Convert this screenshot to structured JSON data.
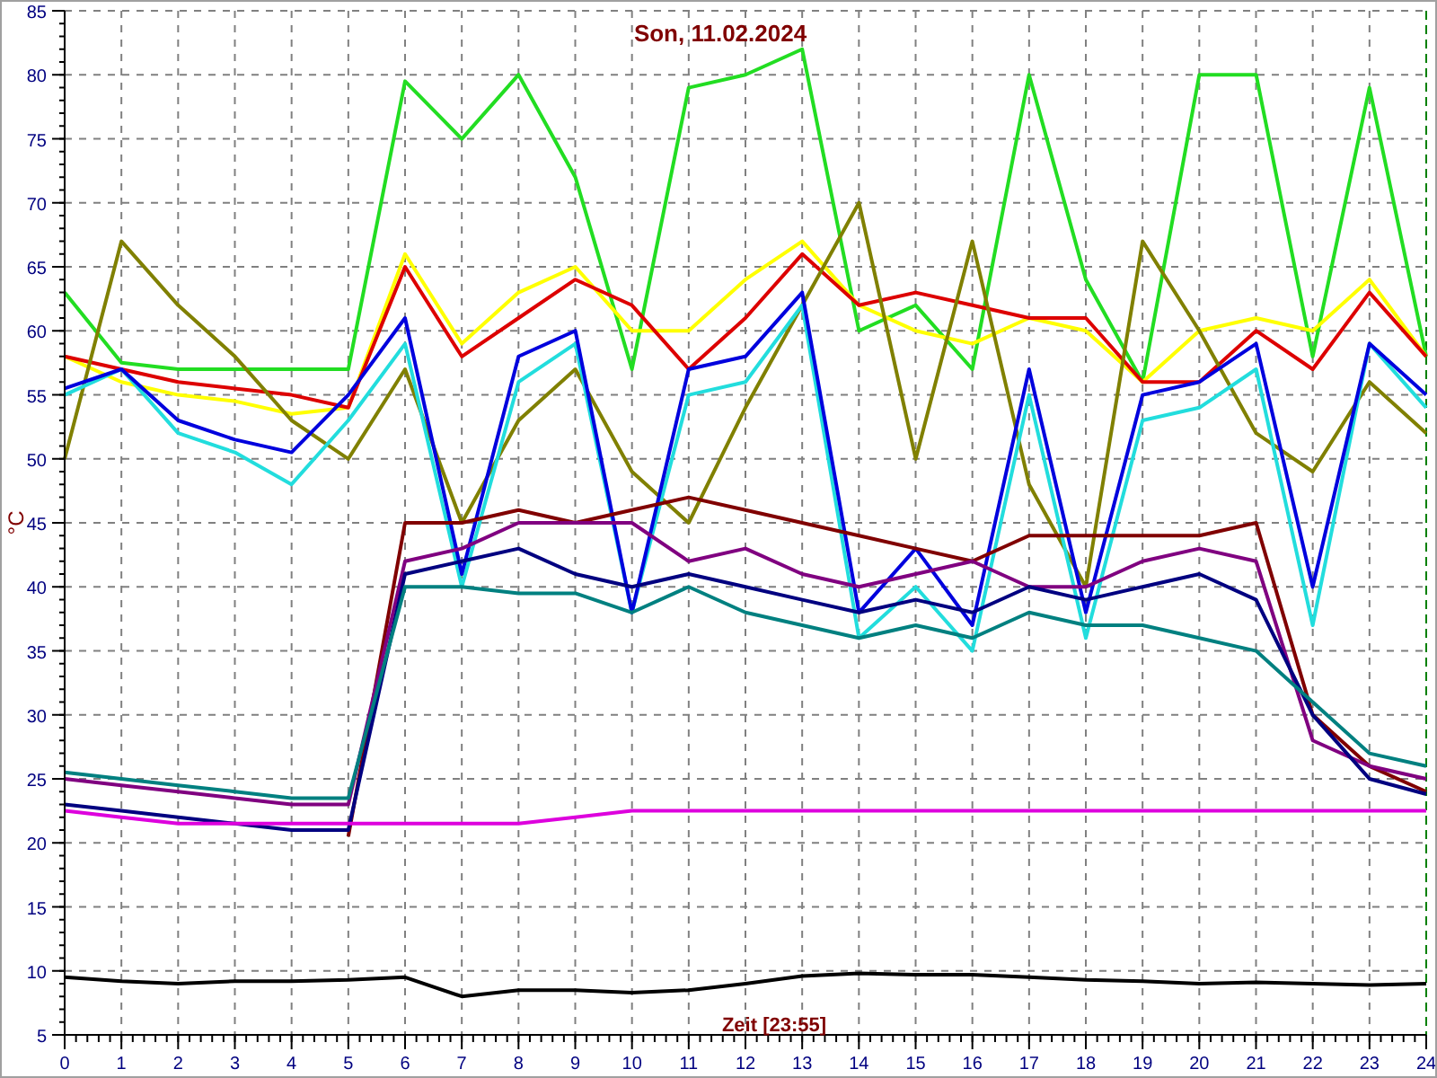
{
  "chart": {
    "chart_data": {
      "type": "line",
      "title": "Son, 11.02.2024",
      "xlabel": "Zeit [23:55]",
      "ylabel": "°C",
      "x": [
        0,
        1,
        2,
        3,
        4,
        5,
        6,
        7,
        8,
        9,
        10,
        11,
        12,
        13,
        14,
        15,
        16,
        17,
        18,
        19,
        20,
        21,
        22,
        23,
        24
      ],
      "grid": true,
      "xlim": [
        0,
        24
      ],
      "ylim": [
        5,
        85
      ],
      "xticks": [
        0,
        1,
        2,
        3,
        4,
        5,
        6,
        7,
        8,
        9,
        10,
        11,
        12,
        13,
        14,
        15,
        16,
        17,
        18,
        19,
        20,
        21,
        22,
        23,
        24
      ],
      "yticks": [
        5,
        10,
        15,
        20,
        25,
        30,
        35,
        40,
        45,
        50,
        55,
        60,
        65,
        70,
        75,
        80,
        85
      ],
      "series": [
        {
          "color": "#22dd22",
          "values": [
            63,
            57.5,
            57,
            57,
            57,
            57,
            79.5,
            75,
            80,
            72,
            57,
            79,
            80,
            82,
            60,
            62,
            57,
            80,
            64,
            56,
            80,
            80,
            58,
            79,
            58
          ]
        },
        {
          "color": "#ffff00",
          "values": [
            58,
            56,
            55,
            54.5,
            53.5,
            54,
            66,
            59,
            63,
            65,
            60,
            60,
            64,
            67,
            62,
            60,
            59,
            61,
            60,
            56,
            60,
            61,
            60,
            64,
            58
          ]
        },
        {
          "color": "#dd0000",
          "values": [
            58,
            57,
            56,
            55.5,
            55,
            54,
            65,
            58,
            61,
            64,
            62,
            57,
            61,
            66,
            62,
            63,
            62,
            61,
            61,
            56,
            56,
            60,
            57,
            63,
            58
          ]
        },
        {
          "color": "#808000",
          "values": [
            50,
            67,
            62,
            58,
            53,
            50,
            57,
            45,
            53,
            57,
            49,
            45,
            54,
            62,
            70,
            50,
            67,
            48,
            40,
            67,
            60,
            52,
            49,
            56,
            52
          ]
        },
        {
          "color": "#22dddd",
          "values": [
            55,
            57,
            52,
            50.5,
            48,
            53,
            59,
            40,
            56,
            59,
            38,
            55,
            56,
            62,
            36,
            40,
            35,
            55,
            36,
            53,
            54,
            57,
            37,
            59,
            54
          ]
        },
        {
          "color": "#0000dd",
          "values": [
            55.5,
            57,
            53,
            51.5,
            50.5,
            55,
            61,
            41,
            58,
            60,
            38,
            57,
            58,
            63,
            38,
            43,
            37,
            57,
            38,
            55,
            56,
            59,
            40,
            59,
            55
          ]
        },
        {
          "color": "#800000",
          "values": [
            null,
            null,
            null,
            null,
            null,
            20.5,
            45,
            45,
            46,
            45,
            46,
            47,
            46,
            45,
            44,
            43,
            42,
            44,
            44,
            44,
            44,
            45,
            30,
            26,
            24
          ]
        },
        {
          "color": "#800080",
          "values": [
            25,
            24.5,
            24,
            23.5,
            23,
            23,
            42,
            43,
            45,
            45,
            45,
            42,
            43,
            41,
            40,
            41,
            42,
            40,
            40,
            42,
            43,
            42,
            28,
            26,
            25
          ]
        },
        {
          "color": "#000080",
          "values": [
            23,
            22.5,
            22,
            21.5,
            21,
            21,
            41,
            42,
            43,
            41,
            40,
            41,
            40,
            39,
            38,
            39,
            38,
            40,
            39,
            40,
            41,
            39,
            30,
            25,
            23.8
          ]
        },
        {
          "color": "#008080",
          "values": [
            25.5,
            25,
            24.5,
            24,
            23.5,
            23.5,
            40,
            40,
            39.5,
            39.5,
            38,
            40,
            38,
            37,
            36,
            37,
            36,
            38,
            37,
            37,
            36,
            35,
            31,
            27,
            26
          ]
        },
        {
          "color": "#dd00dd",
          "values": [
            22.5,
            22,
            21.5,
            21.5,
            21.5,
            21.5,
            21.5,
            21.5,
            21.5,
            22,
            22.5,
            22.5,
            22.5,
            22.5,
            22.5,
            22.5,
            22.5,
            22.5,
            22.5,
            22.5,
            22.5,
            22.5,
            22.5,
            22.5,
            22.5
          ]
        },
        {
          "color": "#000000",
          "values": [
            9.5,
            9.2,
            9,
            9.2,
            9.2,
            9.3,
            9.5,
            8,
            8.5,
            8.5,
            8.3,
            8.5,
            9,
            9.6,
            9.8,
            9.7,
            9.7,
            9.5,
            9.3,
            9.2,
            9,
            9.1,
            9,
            8.9,
            9
          ]
        }
      ]
    }
  }
}
